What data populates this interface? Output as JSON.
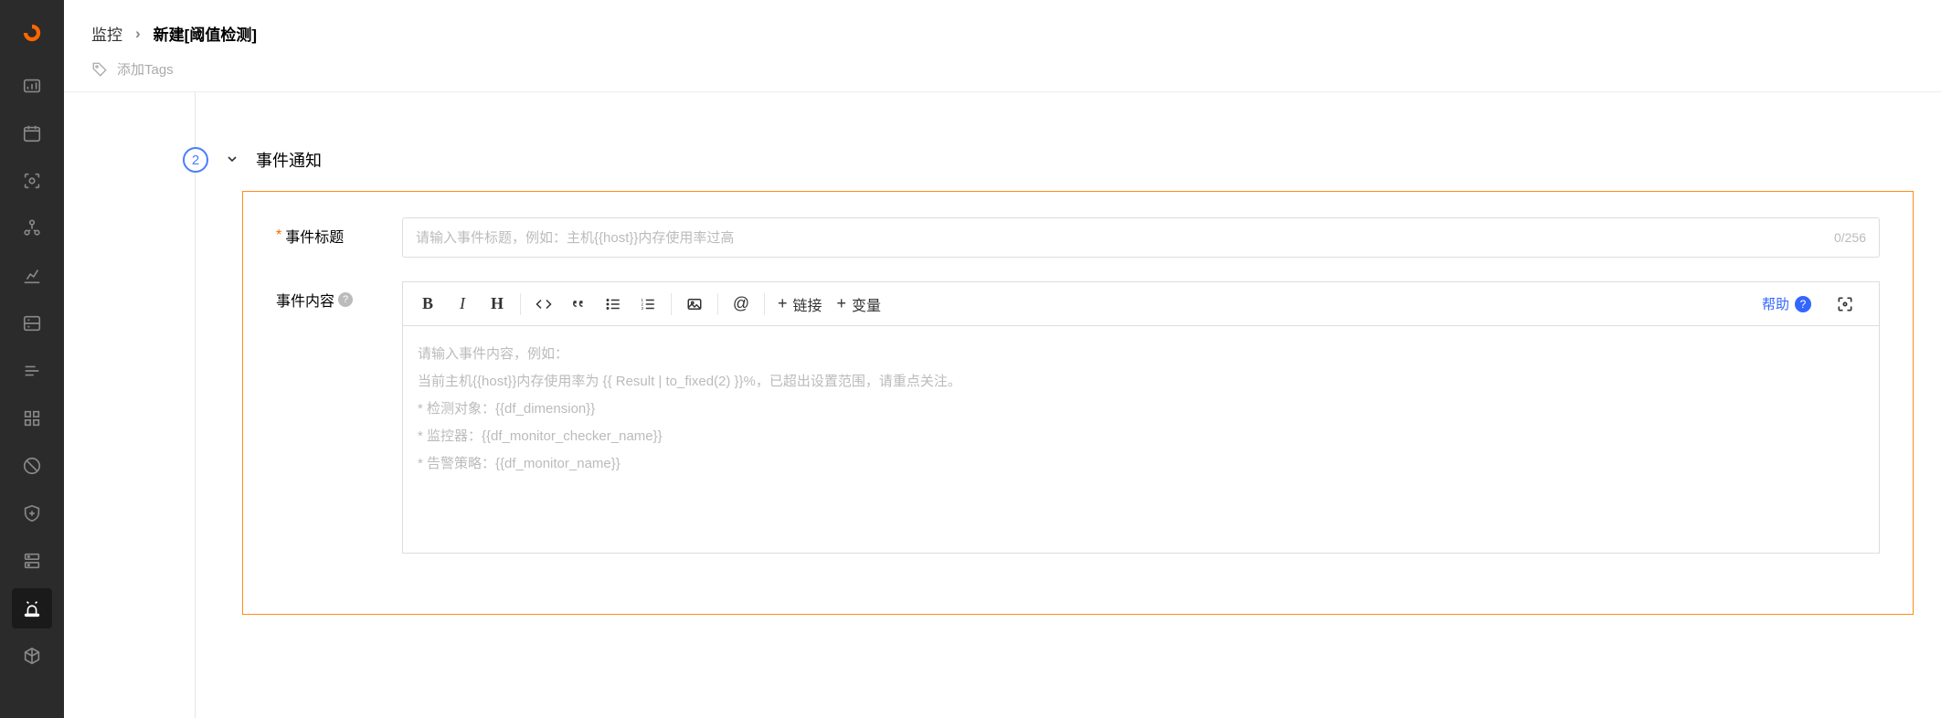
{
  "sidebar": {
    "items": [
      {
        "name": "dashboard",
        "active": false
      },
      {
        "name": "calendar",
        "active": false
      },
      {
        "name": "focus",
        "active": false
      },
      {
        "name": "nodes",
        "active": false
      },
      {
        "name": "analytics",
        "active": false
      },
      {
        "name": "storage",
        "active": false
      },
      {
        "name": "list",
        "active": false
      },
      {
        "name": "grid",
        "active": false
      },
      {
        "name": "block",
        "active": false
      },
      {
        "name": "shield",
        "active": false
      },
      {
        "name": "server",
        "active": false
      },
      {
        "name": "alarm",
        "active": true
      },
      {
        "name": "cube",
        "active": false
      }
    ]
  },
  "breadcrumb": {
    "item1": "监控",
    "current": "新建[阈值检测]"
  },
  "tags": {
    "placeholder": "添加Tags"
  },
  "section": {
    "number": "2",
    "title": "事件通知"
  },
  "form": {
    "title_label": "事件标题",
    "title_placeholder": "请输入事件标题，例如：主机{{host}}内存使用率过高",
    "title_count": "0/256",
    "content_label": "事件内容",
    "content_placeholder_lines": [
      "请输入事件内容，例如：",
      "当前主机{{host}}内存使用率为 {{ Result  | to_fixed(2) }}%，已超出设置范围，请重点关注。",
      "* 检测对象：{{df_dimension}}",
      "* 监控器：{{df_monitor_checker_name}}",
      "* 告警策略：{{df_monitor_name}}"
    ]
  },
  "toolbar": {
    "link": "链接",
    "variable": "变量",
    "help": "帮助"
  }
}
